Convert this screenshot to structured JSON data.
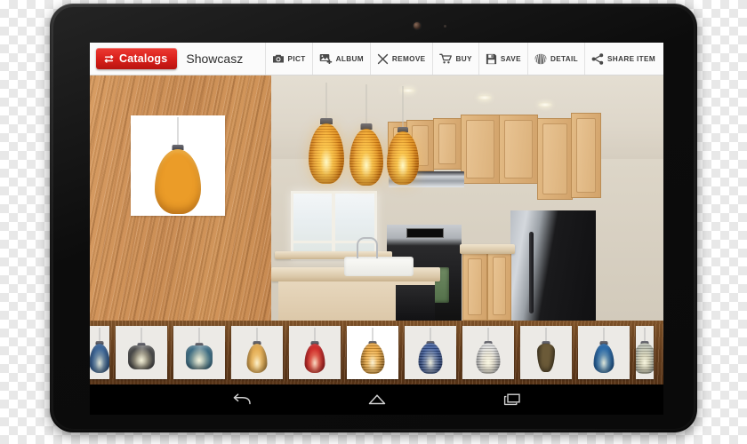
{
  "device": {
    "type": "android-tablet",
    "bezel_color": "#141414",
    "camera_icon": "front-camera",
    "sensor_icon": "light-sensor"
  },
  "appbar": {
    "catalogs_label": "Catalogs",
    "catalogs_icon": "swap-arrows-icon",
    "catalogs_color": "#d9201b",
    "title": "Showcasz",
    "tools": [
      {
        "label": "PICT",
        "icon": "camera-icon"
      },
      {
        "label": "ALBUM",
        "icon": "add-photo-icon"
      },
      {
        "label": "REMOVE",
        "icon": "close-x-icon"
      },
      {
        "label": "BUY",
        "icon": "shopping-cart-icon"
      },
      {
        "label": "SAVE",
        "icon": "floppy-disk-icon"
      },
      {
        "label": "DETAIL",
        "icon": "scallop-shell-icon"
      },
      {
        "label": "SHARE ITEM",
        "icon": "share-nodes-icon"
      }
    ]
  },
  "workspace": {
    "product_panel": {
      "name": "product-preview-panel",
      "background": "wood-grain",
      "background_color": "#cf9055",
      "product_image": "amber-beehive-pendant-lamp",
      "card_color": "#ffffff"
    },
    "room_photo": {
      "name": "kitchen-room-photo",
      "description": "kitchen with island sink, maple cabinets, stainless range and refrigerator",
      "placed_lamps": 3,
      "placed_lamp_type": "amber-beehive-pendant-lamp"
    }
  },
  "thumbnail_strip": {
    "background": "wood-grain",
    "background_color": "#6f4420",
    "selected_index": 5,
    "items": [
      {
        "name": "blue-teardrop-pendant",
        "shape": "teardrop",
        "color": "#2f5d96",
        "partial": true
      },
      {
        "name": "smoke-cube-pendant",
        "shape": "cube",
        "color": "#4a4a4a"
      },
      {
        "name": "blue-cube-pendant",
        "shape": "cube",
        "color": "#3d6d84"
      },
      {
        "name": "amber-teardrop-pendant",
        "shape": "teardrop",
        "color": "#e3a84a"
      },
      {
        "name": "red-teardrop-pendant",
        "shape": "teardrop",
        "color": "#cf2020"
      },
      {
        "name": "amber-beehive-pendant",
        "shape": "beehive",
        "color": "#eb9c28"
      },
      {
        "name": "blue-beehive-pendant",
        "shape": "beehive",
        "color": "#2a4c96"
      },
      {
        "name": "frosted-beehive-pendant",
        "shape": "beehive",
        "color": "#dedede"
      },
      {
        "name": "bronze-cone-pendant",
        "shape": "cone",
        "color": "#6b5a38"
      },
      {
        "name": "blue-glass-pendant",
        "shape": "teardrop",
        "color": "#1e63a8"
      },
      {
        "name": "sage-pendant",
        "shape": "beehive",
        "color": "#b9bdae",
        "partial": true
      }
    ]
  },
  "navbar": {
    "buttons": [
      {
        "label": "Back",
        "icon": "back-arrow-icon"
      },
      {
        "label": "Home",
        "icon": "home-icon"
      },
      {
        "label": "Recents",
        "icon": "recent-apps-icon"
      }
    ]
  }
}
